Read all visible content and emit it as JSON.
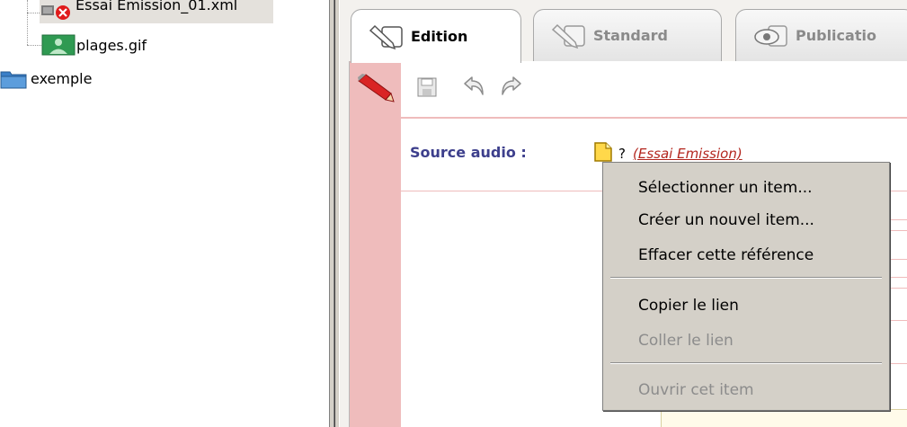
{
  "tree": {
    "items": [
      {
        "label": "Essai Emission_01.xml",
        "icon": "xml-error-icon"
      },
      {
        "label": "plages.gif",
        "icon": "gif-image-icon"
      },
      {
        "label": "exemple",
        "icon": "folder-icon"
      }
    ]
  },
  "tabs": [
    {
      "label": "Edition",
      "icon": "edit-icon",
      "active": true
    },
    {
      "label": "Standard",
      "icon": "edit-icon",
      "active": false
    },
    {
      "label": "Publicatio",
      "icon": "eye-icon",
      "active": false
    }
  ],
  "toolbar": {
    "buttons": [
      "save-icon",
      "undo-icon",
      "redo-icon"
    ]
  },
  "field": {
    "label": "Source audio :",
    "value_prefix": "?",
    "value_link": "(Essai Emission)"
  },
  "context_menu": {
    "items": [
      {
        "label": "Sélectionner un item...",
        "enabled": true
      },
      {
        "label": "Créer un nouvel item...",
        "enabled": true
      },
      {
        "label": "Effacer cette référence",
        "enabled": true
      },
      {
        "label": "Copier le lien",
        "enabled": true
      },
      {
        "label": "Coller le lien",
        "enabled": false
      },
      {
        "label": "Ouvrir cet item",
        "enabled": false
      }
    ]
  },
  "colors": {
    "accent_pink": "#efbcbc",
    "label_blue": "#3d3f8c",
    "link_red": "#b3261e",
    "menu_bg": "#d4d0c8"
  }
}
